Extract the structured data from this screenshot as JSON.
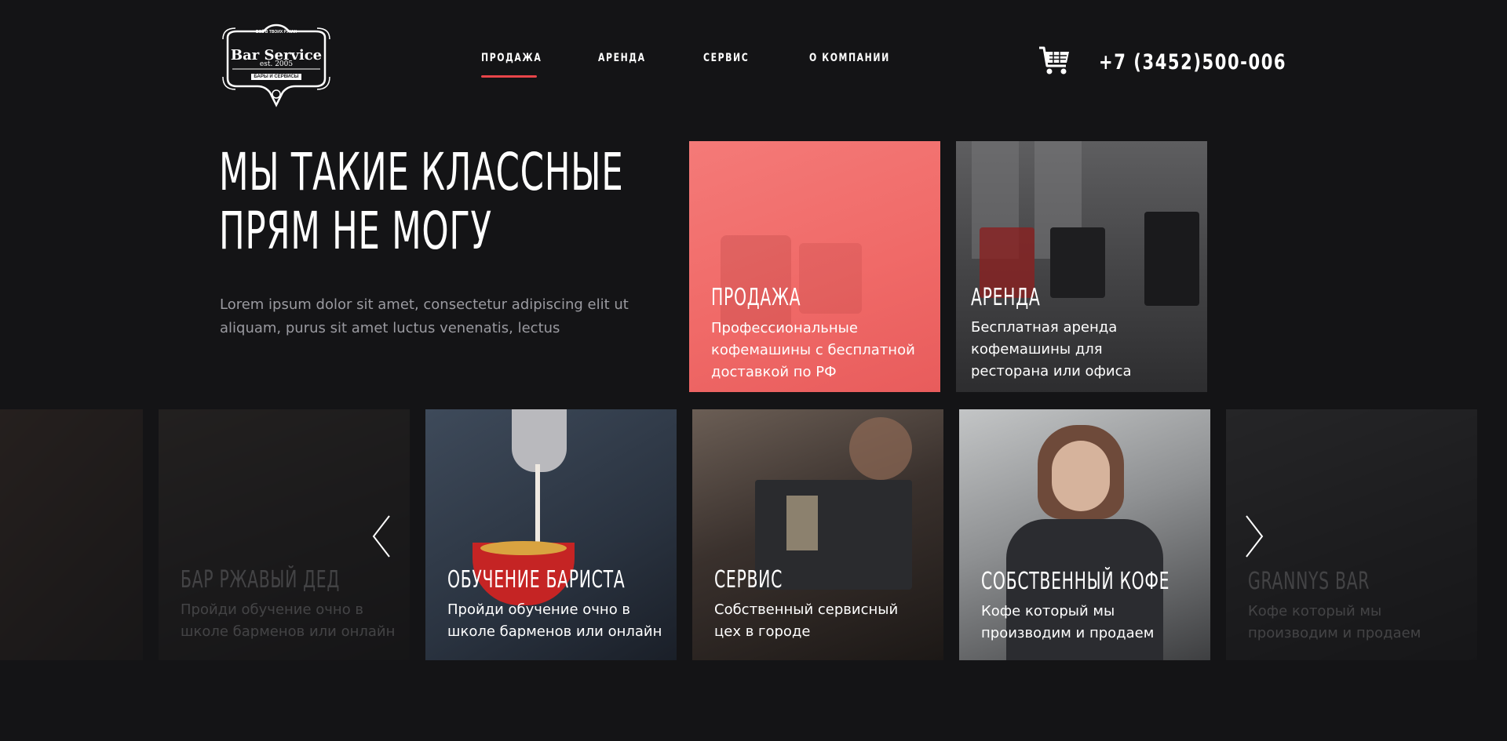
{
  "header": {
    "logo": {
      "line_top": "ВСЁ В ТВОИХ РУКАХ",
      "name": "Bar Service",
      "est": "est. 2005",
      "bottom": "БАРЫ И СЕРВИСЫ"
    },
    "nav": [
      "ПРОДАЖА",
      "АРЕНДА",
      "СЕРВИС",
      "О КОМПАНИИ"
    ],
    "phone": "+7 (3452)500-006",
    "cart_icon": "cart-icon"
  },
  "hero": {
    "title_line1": "МЫ ТАКИЕ КЛАССНЫЕ",
    "title_line2": "ПРЯМ НЕ МОГУ",
    "text": "Lorem ipsum dolor sit amet, consectetur adipiscing elit ut aliquam, purus sit amet luctus venenatis, lectus"
  },
  "top_cards": [
    {
      "title": "ПРОДАЖА",
      "desc": "Профессиональные кофемашины с бесплатной доставкой по РФ"
    },
    {
      "title": "АРЕНДА",
      "desc": "Бесплатная аренда кофемашины для ресторана или офиса"
    }
  ],
  "carousel": [
    {
      "title": "БАР РЖАВЫЙ ДЕД",
      "desc": "Пройди обучение очно в школе барменов или онлайн"
    },
    {
      "title": "ОБУЧЕНИЕ БАРИСТА",
      "desc": "Пройди обучение очно в школе барменов или онлайн"
    },
    {
      "title": "СЕРВИС",
      "desc": "Собственный сервисный цех в городе"
    },
    {
      "title": "СОБСТВЕННЫЙ КОФЕ",
      "desc": "Кофе который мы производим и продаем"
    },
    {
      "title": "GRANNYS BAR",
      "desc": "Кофе который мы производим и продаем"
    }
  ],
  "colors": {
    "background": "#141416",
    "accent": "#e8454a",
    "sale_card": "#f26d6d",
    "muted_text": "#9a9aa0"
  },
  "icons": {
    "prev": "chevron-left-icon",
    "next": "chevron-right-icon"
  }
}
